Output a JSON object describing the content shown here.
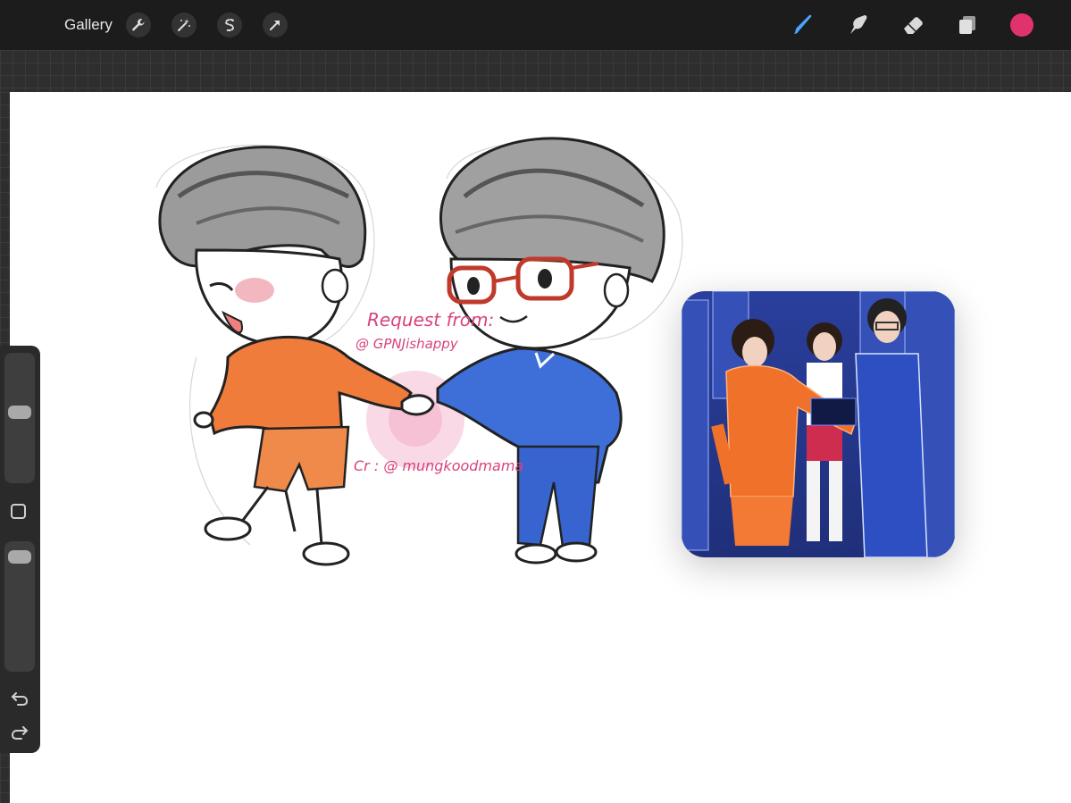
{
  "toolbar": {
    "gallery_label": "Gallery",
    "left_tools": [
      {
        "name": "actions",
        "icon": "wrench-icon"
      },
      {
        "name": "adjustments",
        "icon": "magic-wand-icon"
      },
      {
        "name": "selection",
        "icon": "selection-s-icon"
      },
      {
        "name": "transform",
        "icon": "arrow-cursor-icon"
      }
    ],
    "right_tools": [
      {
        "name": "brush",
        "icon": "brush-icon",
        "active": true
      },
      {
        "name": "smudge",
        "icon": "smudge-icon"
      },
      {
        "name": "eraser",
        "icon": "eraser-icon"
      },
      {
        "name": "layers",
        "icon": "layers-icon"
      }
    ],
    "current_color": "#e0336e",
    "active_tool_color": "#4aa3ff"
  },
  "sidebar": {
    "brush_size_level": 0.55,
    "opacity_level": 0.95,
    "modify_button_icon": "square-icon",
    "undo_icon": "undo-icon",
    "redo_icon": "redo-icon"
  },
  "artwork": {
    "request_line": "Request from:",
    "handle_line": "@ GPNJishappy",
    "credit_line": "Cr : @ mungkoodmama",
    "ink_color": "#d8437d"
  },
  "reference_image": {
    "description_icon": "reference-photo"
  }
}
